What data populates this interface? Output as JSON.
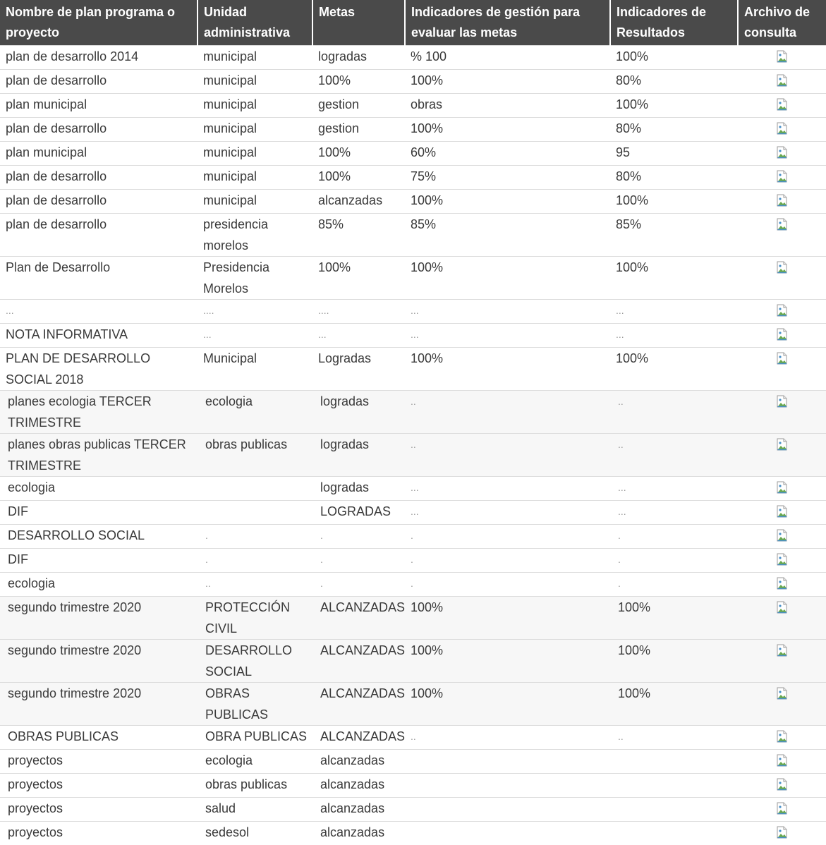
{
  "table": {
    "headers": [
      "Nombre de plan programa o proyecto",
      "Unidad administrativa",
      "Metas",
      "Indicadores de gestión para evaluar las metas",
      "Indicadores de Resultados",
      "Archivo de consulta"
    ],
    "rows": [
      [
        "plan de desarrollo 2014",
        "municipal",
        "logradas",
        "% 100",
        "100%"
      ],
      [
        "plan de desarrollo",
        "municipal",
        "100%",
        "100%",
        "80%"
      ],
      [
        "plan municipal",
        "municipal",
        "gestion",
        "obras",
        "100%"
      ],
      [
        "plan de desarrollo",
        "municipal",
        "gestion",
        "100%",
        "80%"
      ],
      [
        "plan municipal",
        "municipal",
        "100%",
        "60%",
        "95"
      ],
      [
        "plan de desarrollo",
        "municipal",
        "100%",
        "75%",
        "80%"
      ],
      [
        "plan de desarrollo",
        "municipal",
        "alcanzadas",
        "100%",
        "100%"
      ],
      [
        "plan de desarrollo",
        "presidencia morelos",
        "85%",
        "85%",
        "85%"
      ],
      [
        "Plan de Desarrollo",
        "Presidencia Morelos",
        "100%",
        "100%",
        "100%"
      ],
      [
        "...",
        "....",
        "....",
        "...",
        "..."
      ],
      [
        "NOTA INFORMATIVA",
        "...",
        "...",
        "...",
        "..."
      ],
      [
        "PLAN DE DESARROLLO SOCIAL 2018",
        "Municipal",
        "Logradas",
        "100%",
        "100%"
      ],
      [
        "planes ecologia TERCER TRIMESTRE",
        "ecologia",
        "logradas",
        "..",
        ".."
      ],
      [
        "planes obras publicas TERCER TRIMESTRE",
        "obras publicas",
        "logradas",
        "..",
        ".."
      ],
      [
        "ecologia",
        "",
        "logradas",
        "...",
        "..."
      ],
      [
        "DIF",
        "",
        "LOGRADAS",
        "...",
        "..."
      ],
      [
        "DESARROLLO SOCIAL",
        ".",
        ".",
        ".",
        "."
      ],
      [
        "DIF",
        ".",
        ".",
        ".",
        "."
      ],
      [
        "ecologia",
        "..",
        ".",
        ".",
        "."
      ],
      [
        "segundo trimestre 2020",
        "PROTECCIÓN CIVIL",
        "ALCANZADAS",
        "100%",
        "100%"
      ],
      [
        "segundo trimestre 2020",
        "DESARROLLO SOCIAL",
        "ALCANZADAS",
        "100%",
        "100%"
      ],
      [
        "segundo trimestre 2020",
        "OBRAS PUBLICAS",
        "ALCANZADAS",
        "100%",
        "100%"
      ],
      [
        "OBRAS PUBLICAS",
        "OBRA PUBLICAS",
        "ALCANZADAS",
        "..",
        ".."
      ],
      [
        "proyectos",
        "ecologia",
        "alcanzadas",
        "",
        ""
      ],
      [
        "proyectos",
        "obras publicas",
        "alcanzadas",
        "",
        ""
      ],
      [
        "proyectos",
        "salud",
        "alcanzadas",
        "",
        ""
      ],
      [
        "proyectos",
        "sedesol",
        "alcanzadas",
        "",
        ""
      ]
    ],
    "file_icon": "broken-image-icon"
  }
}
